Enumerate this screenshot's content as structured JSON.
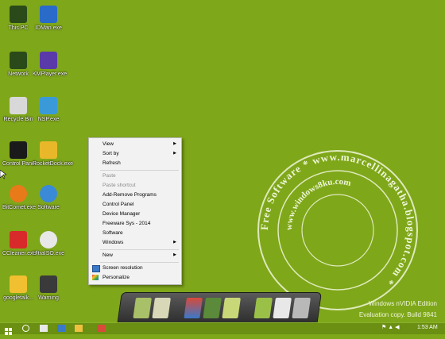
{
  "desktop": {
    "background_color": "#7fa71a",
    "icons": [
      {
        "label": "This PC",
        "icon": "computer-icon"
      },
      {
        "label": "IDMan.exe",
        "icon": "download-manager-icon"
      },
      {
        "label": "Network",
        "icon": "network-icon"
      },
      {
        "label": "KMPlayer.exe",
        "icon": "media-player-icon"
      },
      {
        "label": "Recycle Bin",
        "icon": "recycle-bin-icon"
      },
      {
        "label": "NSP.exe",
        "icon": "lock-icon"
      },
      {
        "label": "Control Panel",
        "icon": "control-panel-icon"
      },
      {
        "label": "RocketDock.exe",
        "icon": "rocketdock-icon"
      },
      {
        "label": "BitComet.exe",
        "icon": "bitcomet-icon"
      },
      {
        "label": "Software",
        "icon": "ie-icon"
      },
      {
        "label": "CCleaner.exe",
        "icon": "ccleaner-icon"
      },
      {
        "label": "UltraISO.exe",
        "icon": "disc-icon"
      },
      {
        "label": "googletalk...",
        "icon": "chat-icon"
      },
      {
        "label": "Warning",
        "icon": "warning-icon"
      }
    ]
  },
  "context_menu": {
    "items": [
      {
        "label": "View",
        "submenu": true
      },
      {
        "label": "Sort by",
        "submenu": true
      },
      {
        "label": "Refresh"
      },
      {
        "label": "Paste",
        "disabled": true
      },
      {
        "label": "Paste shortcut",
        "disabled": true
      },
      {
        "label": "Add-Remove Programs"
      },
      {
        "label": "Control Panel"
      },
      {
        "label": "Device Manager"
      },
      {
        "label": "Freeware Sys - 2014"
      },
      {
        "label": "Software"
      },
      {
        "label": "Windows",
        "submenu": true
      },
      {
        "label": "New",
        "submenu": true
      },
      {
        "label": "Screen resolution",
        "icon": "display-icon"
      },
      {
        "label": "Personalize",
        "icon": "personalize-icon"
      }
    ],
    "arrow_glyph": "▶"
  },
  "watermark_stamp": {
    "outer_text": "Free Software * www.marcellinagatha.blogspot.com *",
    "inner_text": "www.windows8ku.com"
  },
  "system_watermark": {
    "line1": "Windows nVIDIA Edition",
    "line2": "Evaluation copy. Build 9841"
  },
  "taskbar": {
    "clock": "1:53 AM"
  }
}
